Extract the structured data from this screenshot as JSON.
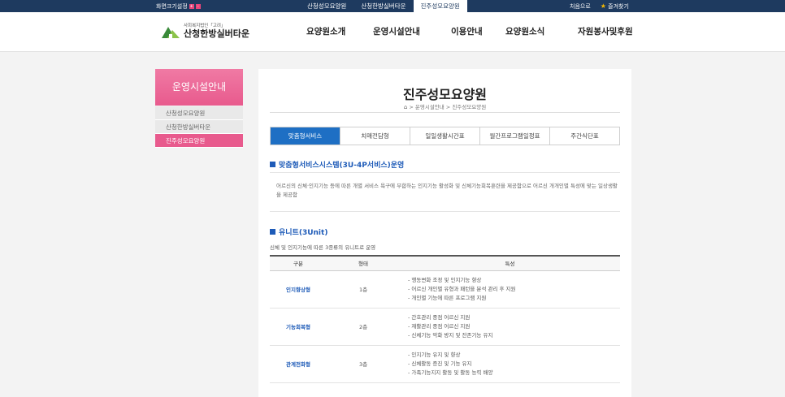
{
  "topbar": {
    "font_size_label": "화면크기설정",
    "font_plus": "+",
    "font_minus": "-",
    "site_tabs": [
      "산청성모요양원",
      "산청한방실버타운",
      "진주성모요양원"
    ],
    "active_site_tab": 2,
    "home_label": "처음으로",
    "favorite_label": "즐겨찾기"
  },
  "header": {
    "logo_sub": "사회복지법인「고려」",
    "logo_name": "산청한방실버타운",
    "nav": [
      "요양원소개",
      "운영시설안내",
      "이용안내",
      "요양원소식",
      "자원봉사및후원"
    ]
  },
  "sidebar": {
    "title": "운영시설안내",
    "items": [
      "산청성모요양원",
      "산청한방실버타운",
      "진주성모요양원"
    ],
    "active_index": 2
  },
  "main": {
    "title": "진주성모요양원",
    "breadcrumb": "> 운영시설안내 > 진주성모요양원",
    "tabs": [
      "맞춤형서비스",
      "치매전담형",
      "일일생활시간표",
      "월간프로그램일정표",
      "주간식단표"
    ],
    "active_tab": 0,
    "section1": {
      "heading": "맞춤형서비스시스템(3U-4P서비스)운영",
      "text": "어르신의 신체·인지기능 등에 따른 개별 서비스 욕구에 부합하는 인지기능 활성화 및 신체기능회복훈련을 제공함으로 어르신 개개인별 특성에 맞는 일상생활을 제공함"
    },
    "section2": {
      "heading": "유니트(3Unit)",
      "desc": "신체 및 인지기능에 따른 3종류의 유니트로 운영",
      "table": {
        "headers": [
          "구분",
          "형태",
          "특성"
        ],
        "rows": [
          {
            "type": "인지향상형",
            "form": "1층",
            "features": [
              "- 행동변화 조정 및 인지기능 향상",
              "- 어르신 개인별 유형과 패턴을 분석 관리 후 지원",
              "- 개인별 기능에 따른 프로그램 지원"
            ]
          },
          {
            "type": "기능회복형",
            "form": "2층",
            "features": [
              "- 간호관리 중점 어르신 지원",
              "- 재활관리 중점 어르신 지원",
              "- 신체기능 악화 방지 및 잔존기능 유지"
            ]
          },
          {
            "type": "관계전화형",
            "form": "3층",
            "features": [
              "- 인지기능 유지 및 향상",
              "- 신체활동 증진 및 기능 유지",
              "- 가족기능지지 활동 및 활동 능력 배양"
            ]
          }
        ]
      }
    }
  },
  "colors": {
    "topbar": "#1e3a5f",
    "accent_pink": "#e85a8d",
    "accent_blue": "#1e6fc4",
    "heading_blue": "#1e5bb8"
  }
}
